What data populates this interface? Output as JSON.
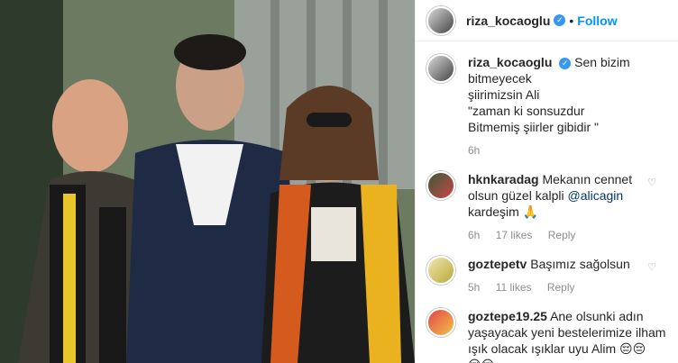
{
  "post": {
    "username": "riza_kocaoglu",
    "follow_label": "Follow",
    "dot": "•"
  },
  "caption": {
    "username": "riza_kocaoglu",
    "line1": "Sen bizim bitmeyecek",
    "line2": "şiirimizsin Ali",
    "line3": "\"zaman ki sonsuzdur",
    "line4": "Bitmemiş şiirler gibidir \"",
    "time": "6h"
  },
  "comments": [
    {
      "username": "hknkaradag",
      "text_a": "Mekanın cennet",
      "text_b": "olsun güzel kalpli",
      "mention": "@alicagin",
      "text_c": "kardeşim 🙏",
      "time": "6h",
      "likes": "17 likes",
      "reply": "Reply"
    },
    {
      "username": "goztepetv",
      "text_a": "Başımız sağolsun",
      "time": "5h",
      "likes": "11 likes",
      "reply": "Reply"
    },
    {
      "username": "goztepe19.25",
      "text_a": "Ane olsunki adın",
      "text_b": "yaşayacak yeni bestelerimize ilham",
      "text_c": "ışık olacak ışıklar uyu Alim 😔😔",
      "text_d": "😔😔"
    }
  ],
  "colors": {
    "accent": "#0095f6",
    "verified": "#3897f0",
    "muted": "#8e8e8e"
  }
}
